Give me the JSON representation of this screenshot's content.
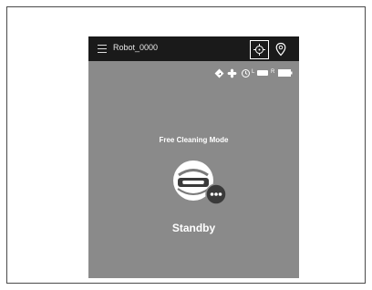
{
  "header": {
    "title": "Robot_0000"
  },
  "status_bar": {
    "left_label": "L",
    "right_label": "R"
  },
  "main": {
    "mode": "Free Cleaning Mode",
    "status": "Standby"
  },
  "icons": [
    "menu-icon",
    "locate-icon",
    "map-pin-icon",
    "navigation-icon",
    "fan-icon",
    "timer-icon",
    "brush-icon",
    "battery-icon",
    "more-icon"
  ],
  "colors": {
    "background": "#8a8a8a",
    "topbar": "#1a1a1a",
    "text": "#ffffff"
  }
}
